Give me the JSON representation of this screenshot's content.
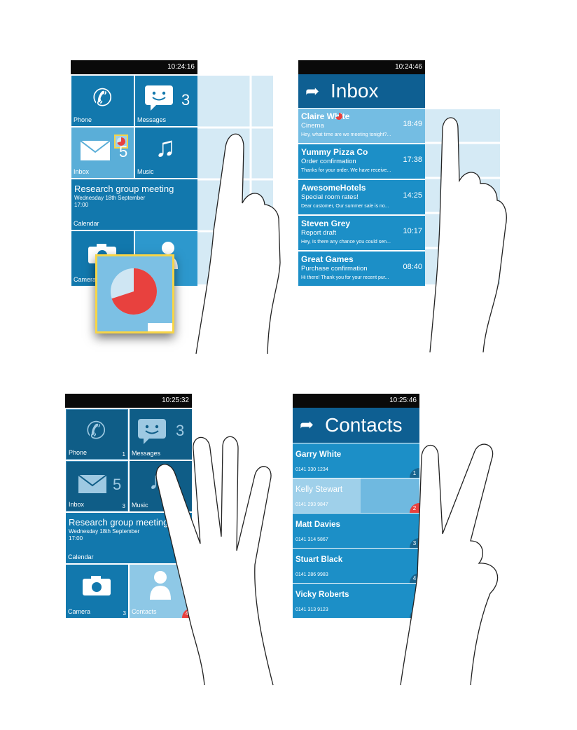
{
  "panel1": {
    "clock": "10:24:16",
    "tiles": {
      "phone": {
        "label": "Phone"
      },
      "messages": {
        "label": "Messages",
        "count": "3"
      },
      "inbox": {
        "label": "Inbox",
        "count": "5"
      },
      "music": {
        "label": "Music"
      },
      "calendar": {
        "title": "Research group meeting",
        "date": "Wednesday 18th September",
        "time": "17:00",
        "label": "Calendar"
      },
      "camera": {
        "label": "Camera"
      }
    }
  },
  "panel2": {
    "clock": "10:24:46",
    "title": "Inbox",
    "emails": [
      {
        "sender": "Claire White",
        "subject": "Cinema",
        "preview": "Hey, what time are we meeting tonight?...",
        "time": "18:49"
      },
      {
        "sender": "Yummy Pizza Co",
        "subject": "Order confirmation",
        "preview": "Thanks for your order.  We have receive...",
        "time": "17:38"
      },
      {
        "sender": "AwesomeHotels",
        "subject": "Special room rates!",
        "preview": "Dear customer,  Our summer sale is no...",
        "time": "14:25"
      },
      {
        "sender": "Steven Grey",
        "subject": "Report draft",
        "preview": "Hey,  Is there any chance you could sen...",
        "time": "10:17"
      },
      {
        "sender": "Great Games",
        "subject": "Purchase confirmation",
        "preview": "Hi there!  Thank you for your recent pur...",
        "time": "08:40"
      }
    ]
  },
  "panel3": {
    "clock": "10:25:32",
    "tiles": {
      "phone": {
        "label": "Phone",
        "index": "1"
      },
      "messages": {
        "label": "Messages",
        "count": "3"
      },
      "inbox": {
        "label": "Inbox",
        "count": "5",
        "index": "3"
      },
      "music": {
        "label": "Music"
      },
      "calendar": {
        "title": "Research group meeting",
        "date": "Wednesday 18th September",
        "time": "17:00",
        "label": "Calendar"
      },
      "camera": {
        "label": "Camera",
        "index": "3"
      },
      "contacts": {
        "label": "Contacts",
        "index": "4"
      }
    }
  },
  "panel4": {
    "clock": "10:25:46",
    "title": "Contacts",
    "contacts": [
      {
        "name": "Garry White",
        "phone": "0141 330 1234",
        "index": "1"
      },
      {
        "name": "Kelly Stewart",
        "phone": "0141 293 9847",
        "index": "2"
      },
      {
        "name": "Matt Davies",
        "phone": "0141 314 5867",
        "index": "3"
      },
      {
        "name": "Stuart Black",
        "phone": "0141 286 9983",
        "index": "4"
      },
      {
        "name": "Vicky Roberts",
        "phone": "0141 313 9123",
        "index": "5"
      }
    ]
  },
  "colors": {
    "tile": "#1278ad",
    "row": "#1c8fc7",
    "header": "#0e5f92",
    "highlight": "#f7d547",
    "badge": "#e8413e"
  }
}
